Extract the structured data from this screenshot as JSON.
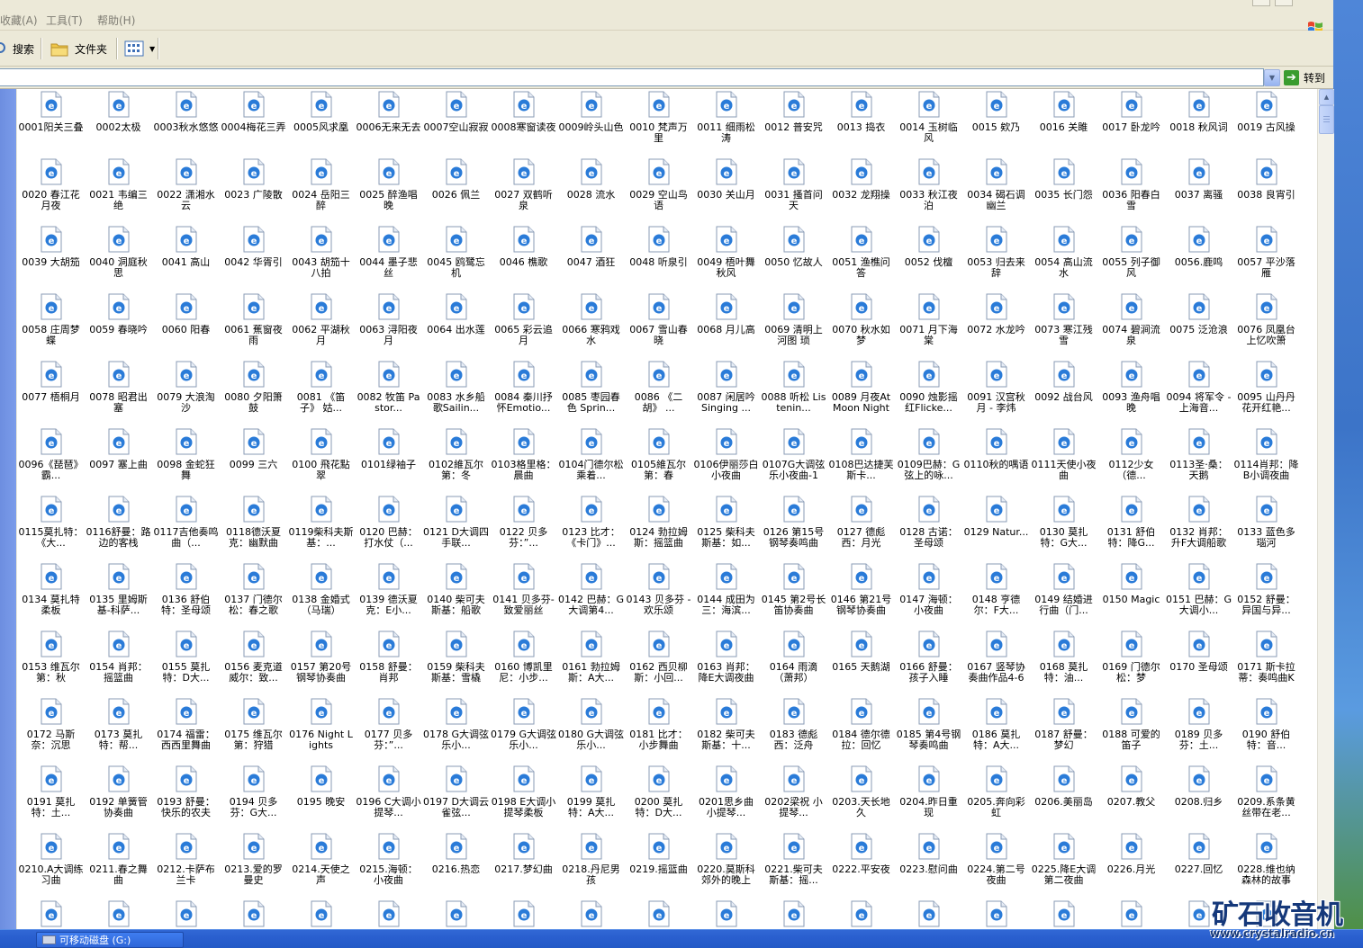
{
  "menubar": {
    "items": [
      "收藏(A)",
      "工具(T)",
      "帮助(H)"
    ]
  },
  "toolbar": {
    "search_label": "搜索",
    "folders_label": "文件夹"
  },
  "addressbar": {
    "go_label": "转到"
  },
  "files": [
    "0001阳关三叠",
    "0002太极",
    "0003秋水悠悠",
    "0004梅花三弄",
    "0005风求凰",
    "0006无来无去",
    "0007空山寂寂",
    "0008寒窗读夜",
    "0009岭头山色",
    "0010 梵声万里",
    "0011 细雨松涛",
    "0012 普安咒",
    "0013 捣衣",
    "0014 玉树临风",
    "0015 欸乃",
    "0016 关雎",
    "0017 卧龙吟",
    "0018 秋风词",
    "0019 古风操",
    "0020 春江花月夜",
    "0021 韦编三绝",
    "0022 潇湘水云",
    "0023 广陵散",
    "0024 岳阳三醉",
    "0025 醉渔唱晚",
    "0026 佩兰",
    "0027 双鹤听泉",
    "0028 流水",
    "0029 空山鸟语",
    "0030 关山月",
    "0031 搔首问天",
    "0032 龙翔操",
    "0033 秋江夜泊",
    "0034 碣石调幽兰",
    "0035 长门怨",
    "0036 阳春白雪",
    "0037 离骚",
    "0038 良宵引",
    "0039 大胡笳",
    "0040 洞庭秋思",
    "0041 高山",
    "0042 华胥引",
    "0043 胡笳十八拍",
    "0044 墨子悲丝",
    "0045 鸥鹭忘机",
    "0046 樵歌",
    "0047 酒狂",
    "0048 听泉引",
    "0049 梧叶舞秋风",
    "0050 忆故人",
    "0051 渔樵问答",
    "0052 伐檀",
    "0053 归去来辞",
    "0054 高山流水",
    "0055 列子御风",
    "0056.鹿鸣",
    "0057 平沙落雁",
    "0058 庄周梦蝶",
    "0059 春晓吟",
    "0060 阳春",
    "0061 蕉窗夜雨",
    "0062 平湖秋月",
    "0063 浔阳夜月",
    "0064 出水莲",
    "0065 彩云追月",
    "0066 寒鸦戏水",
    "0067 雪山春晓",
    "0068 月儿高",
    "0069 清明上河图 琐",
    "0070 秋水如梦",
    "0071 月下海棠",
    "0072 水龙吟",
    "0073 寒江残雪",
    "0074 碧涧流泉",
    "0075 泛沧浪",
    "0076 凤凰台上忆吹箫",
    "0077 梧桐月",
    "0078 昭君出塞",
    "0079 大浪淘沙",
    "0080 夕阳箫鼓",
    "0081 《笛子》 姑...",
    "0082 牧笛 Pastor...",
    "0083 水乡船歌Sailin...",
    "0084 秦川抒怀Emotio...",
    "0085 枣园春色 Sprin...",
    "0086 《二胡》 ...",
    "0087 闲居吟 Singing ...",
    "0088 听松 Listenin...",
    "0089 月夜At Moon Night",
    "0090 烛影摇红Flicke...",
    "0091 汉宫秋月 - 李炜",
    "0092 战台风",
    "0093 渔舟唱晚",
    "0094 将军令 - 上海音...",
    "0095 山丹丹花开红艳...",
    "0096《琵琶》 霸...",
    "0097 塞上曲",
    "0098 金蛇狂舞",
    "0099 三六",
    "0100 飛花點翠",
    "0101绿袖子",
    "0102維瓦尔第：冬",
    "0103格里格：晨曲",
    "0104门德尔松 乘着...",
    "0105維瓦尔第：春",
    "0106伊丽莎白小夜曲",
    "0107G大调弦乐小夜曲-1",
    "0108巴达捷芙斯卡...",
    "0109巴赫：G弦上的咏...",
    "0110秋的喁语",
    "0111天使小夜曲",
    "0112少女（德...",
    "0113圣·桑：天鹅",
    "0114肖邦：降B小调夜曲",
    "0115莫扎特：《大...",
    "0116舒曼：路边的客栈",
    "0117吉他奏鸣曲（...",
    "0118德沃夏克：幽默曲",
    "0119柴科夫斯基：...",
    "0120 巴赫：打水仗（...",
    "0121 D大调四手联...",
    "0122 贝多芬：”...",
    "0123 比才：《卡门》...",
    "0124 勃拉姆斯：摇篮曲",
    "0125 柴科夫斯基：如...",
    "0126 第15号钢琴奏鸣曲",
    "0127 德彪西：月光",
    "0128 古诺：圣母颂",
    "0129 Natur...",
    "0130 莫扎特：G大...",
    "0131 舒伯特：降G...",
    "0132 肖邦：升F大调船歌",
    "0133 蓝色多瑙河",
    "0134 莫扎特柔板",
    "0135 里姆斯基-科萨...",
    "0136 舒伯特：圣母颂",
    "0137 门德尔松：春之歌",
    "0138 金婚式（马瑞）",
    "0139 德沃夏克：E小...",
    "0140 柴可夫斯基：船歌",
    "0141 贝多芬-致爱丽丝",
    "0142 巴赫：G大调第4...",
    "0143 贝多芬 - 欢乐颂",
    "0144 成田为三：海滨...",
    "0145 第2号长笛协奏曲",
    "0146 第21号钢琴协奏曲",
    "0147 海顿：小夜曲",
    "0148 亨德尔：F大...",
    "0149 结婚进行曲（门...",
    "0150 Magic",
    "0151 巴赫：G大调小...",
    "0152 舒曼：异国与异...",
    "0153 维瓦尔第：秋",
    "0154 肖邦：摇篮曲",
    "0155 莫扎特：D大...",
    "0156 麦克道威尔：致...",
    "0157 第20号钢琴协奏曲",
    "0158 舒曼：肖邦",
    "0159 柴科夫斯基：雪橇",
    "0160 博凯里尼：小步...",
    "0161 勃拉姆斯：A大...",
    "0162 西贝柳斯：小回...",
    "0163 肖邦：降E大调夜曲",
    "0164 雨滴（萧邦）",
    "0165 天鹅湖",
    "0166 舒曼：孩子入睡",
    "0167 竖琴协奏曲作品4-6",
    "0168 莫扎特：油...",
    "0169 门德尔松：梦",
    "0170 圣母颂",
    "0171 斯卡拉蒂：奏鸣曲K",
    "0172 马斯奈：沉思",
    "0173 莫扎特：帮...",
    "0174 福雷：西西里舞曲",
    "0175 维瓦尔第：狩猎",
    "0176 Night Lights",
    "0177 贝多芬：”...",
    "0178 G大调弦乐小...",
    "0179 G大调弦乐小...",
    "0180 G大调弦乐小...",
    "0181 比才：小步舞曲",
    "0182 柴可夫斯基：十...",
    "0183 德彪西：泛舟",
    "0184 德尔德拉：回忆",
    "0185 第4号钢琴奏鸣曲",
    "0186 莫扎特：A大...",
    "0187 舒曼：梦幻",
    "0188 可爱的笛子",
    "0189 贝多芬：土...",
    "0190 舒伯特：音...",
    "0191 莫扎特：土...",
    "0192 单簧管协奏曲",
    "0193 舒曼：快乐的农夫",
    "0194 贝多芬：G大...",
    "0195 晚安",
    "0196 C大调小提琴...",
    "0197 D大调云雀弦...",
    "0198 E大调小提琴柔板",
    "0199 莫扎特：A大...",
    "0200 莫扎特：D大...",
    "0201思乡曲 小提琴...",
    "0202梁祝 小提琴...",
    "0203.天长地久",
    "0204.昨日重现",
    "0205.奔向彩虹",
    "0206.美丽岛",
    "0207.教父",
    "0208.归乡",
    "0209.系条黄丝带在老...",
    "0210.A大调练习曲",
    "0211.春之舞曲",
    "0212.卡萨布兰卡",
    "0213.爱的罗曼史",
    "0214.天使之声",
    "0215.海顿：小夜曲",
    "0216.热恋",
    "0217.梦幻曲",
    "0218.丹尼男孩",
    "0219.摇篮曲",
    "0220.莫斯科郊外的晚上",
    "0221.柴可夫斯基：摇...",
    "0222.平安夜",
    "0223.慰问曲",
    "0224.第二号夜曲",
    "0225.降E大调第二夜曲",
    "0226.月光",
    "0227.回忆",
    "0228.维也纳森林的故事",
    "",
    "",
    "",
    "",
    "",
    "",
    "",
    "",
    "",
    "",
    "",
    "",
    "",
    "",
    "",
    "",
    "",
    "",
    ""
  ],
  "taskbar": {
    "task_label": "可移动磁盘 (G:)"
  },
  "watermark": {
    "title": "矿石收音机",
    "url": "www.crystalradio.cn"
  },
  "colors": {
    "window_bg": "#ece9d8",
    "file_area_bg": "#ffffff",
    "ie_icon_blue": "#2a7bd8",
    "taskbar_blue": "#245ac6"
  }
}
